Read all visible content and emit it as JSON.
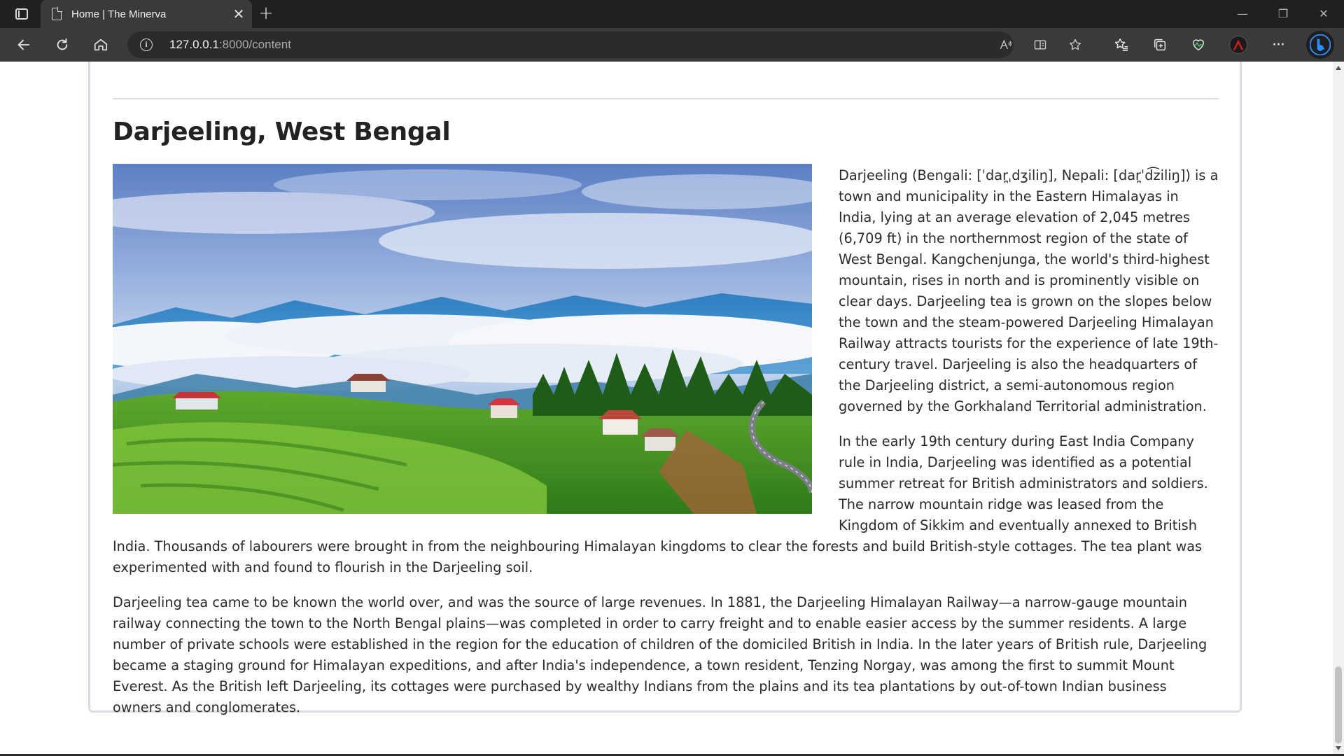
{
  "browser": {
    "tab_title": "Home | The Minerva",
    "tab_close": "✕",
    "new_tab": "+",
    "url_host": "127.0.0.1",
    "url_path": ":8000/content",
    "icons": [
      "tab-actions-icon",
      "page-icon",
      "back-icon",
      "refresh-icon",
      "home-icon",
      "site-info-icon",
      "read-aloud-icon",
      "immersive-reader-icon",
      "favorite-star-icon",
      "favorites-icon",
      "collections-icon",
      "health-icon",
      "profile-icon",
      "more-icon",
      "bing-icon"
    ],
    "window_controls": {
      "minimize": "—",
      "restore": "❐",
      "close": "✕"
    },
    "more_label": "···"
  },
  "colors": {
    "titlebar": "#202020",
    "toolbar": "#3a3a3a",
    "card_border": "#d9dde3",
    "text": "#2a2a2a",
    "bing_accent": "#2b8cff"
  },
  "article": {
    "title": "Darjeeling, West Bengal",
    "paragraphs": [
      "Darjeeling (Bengali: [ˈdar̪ˌdʒiliŋ], Nepali: [dar̪ˈd͡ziliŋ]) is a town and municipality in the Eastern Himalayas in India, lying at an average elevation of 2,045 metres (6,709 ft) in the northernmost region of the state of West Bengal. Kangchenjunga, the world's third-highest mountain, rises in north and is prominently visible on clear days. Darjeeling tea is grown on the slopes below the town and the steam-powered Darjeeling Himalayan Railway attracts tourists for the experience of late 19th-century travel. Darjeeling is also the headquarters of the Darjeeling district, a semi-autonomous region governed by the Gorkhaland Territorial administration.",
      "In the early 19th century during East India Company rule in India, Darjeeling was identified as a potential summer retreat for British administrators and soldiers. The narrow mountain ridge was leased from the Kingdom of Sikkim and eventually annexed to British India. Thousands of labourers were brought in from the neighbouring Himalayan kingdoms to clear the forests and build British-style cottages. The tea plant was experimented with and found to flourish in the Darjeeling soil.",
      "Darjeeling tea came to be known the world over, and was the source of large revenues. In 1881, the Darjeeling Himalayan Railway—a narrow-gauge mountain railway connecting the town to the North Bengal plains—was completed in order to carry freight and to enable easier access by the summer residents. A large number of private schools were established in the region for the education of children of the domiciled British in India. In the later years of British rule, Darjeeling became a staging ground for Himalayan expeditions, and after India's independence, a town resident, Tenzing Norgay, was among the first to summit Mount Everest. As the British left Darjeeling, its cottages were purchased by wealthy Indians from the plains and its tea plantations by out-of-town Indian business owners and conglomerates."
    ]
  }
}
